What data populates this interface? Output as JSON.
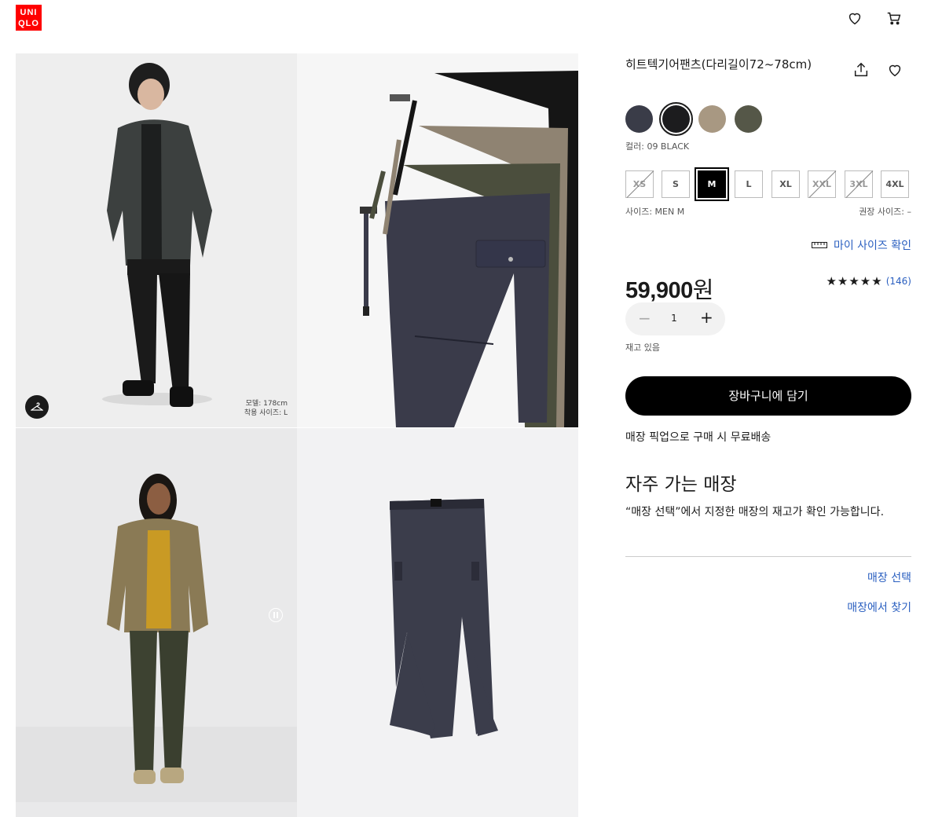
{
  "header": {
    "logo_line1": "UNI",
    "logo_line2": "QLO"
  },
  "gallery": {
    "model_height": "모델: 178cm",
    "model_size": "착용 사이즈: L"
  },
  "product": {
    "title": "히트텍기어팬츠(다리길이72~78cm)",
    "colors": [
      {
        "name": "navy",
        "hex": "#3a3c48"
      },
      {
        "name": "black",
        "hex": "#1c1c1e"
      },
      {
        "name": "beige",
        "hex": "#a89882"
      },
      {
        "name": "olive",
        "hex": "#555748"
      }
    ],
    "color_label": "컬러: 09 BLACK",
    "sizes": [
      "XS",
      "S",
      "M",
      "L",
      "XL",
      "XXL",
      "3XL",
      "4XL"
    ],
    "selected_size": "M",
    "unavailable_sizes": [
      "XS",
      "XXL",
      "3XL"
    ],
    "size_label": "사이즈: MEN M",
    "recommended_label": "권장 사이즈: –",
    "my_size_link": "마이 사이즈 확인",
    "price_number": "59,900",
    "price_unit": "원",
    "rating_stars": "★★★★★",
    "rating_value": 4.5,
    "review_count": "(146)",
    "quantity": "1",
    "stock_status": "재고 있음",
    "add_to_cart": "장바구니에 담기",
    "pickup_note": "매장 픽업으로 구매 시 무료배송"
  },
  "store": {
    "heading": "자주 가는 매장",
    "description": "“매장 선택”에서 지정한 매장의 재고가 확인 가능합니다.",
    "select_link": "매장 선택",
    "find_link": "매장에서 찾기"
  }
}
